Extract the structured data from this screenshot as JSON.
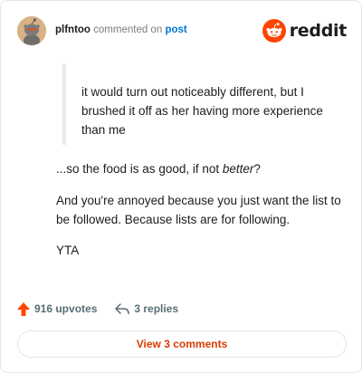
{
  "header": {
    "username": "plfntoo",
    "commented_on": "commented on",
    "post_link": "post",
    "brand": "reddit"
  },
  "comment": {
    "quote": "it would turn out noticeably different, but I brushed it off as her having more experience than me",
    "paragraph1_prefix": "...so the food is as good, if not ",
    "paragraph1_emphasis": "better",
    "paragraph1_suffix": "?",
    "paragraph2": "And you're annoyed because you just want the list to be followed. Because lists are for following.",
    "paragraph3": "YTA"
  },
  "actions": {
    "upvotes": "916 upvotes",
    "replies": "3 replies"
  },
  "footer": {
    "view_comments": "View 3 comments"
  },
  "colors": {
    "brand_orange": "#ff4500",
    "link_blue": "#0079d3",
    "cta_orange": "#d93a00",
    "muted": "#576f76"
  },
  "icons": {
    "avatar": "snoo-avatar",
    "logo": "reddit-alien-icon",
    "upvote": "upvote-arrow-icon",
    "reply": "reply-arrow-icon"
  }
}
